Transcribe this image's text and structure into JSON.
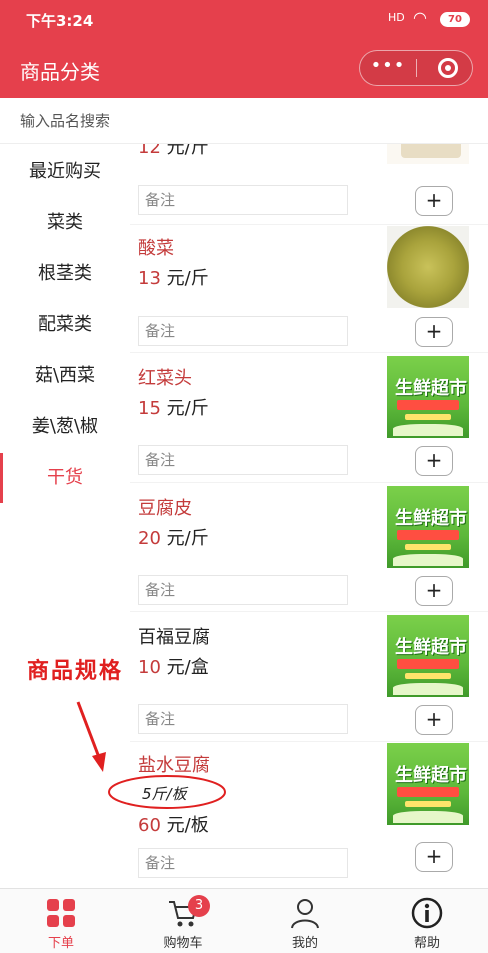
{
  "status": {
    "time": "下午3:24",
    "signal": "HD",
    "battery": "70"
  },
  "header": {
    "title": "商品分类",
    "more_glyph": "•••"
  },
  "search": {
    "placeholder": "输入品名搜索"
  },
  "sidebar": {
    "items": [
      {
        "label": "最近购买",
        "active": false
      },
      {
        "label": "菜类",
        "active": false
      },
      {
        "label": "根茎类",
        "active": false
      },
      {
        "label": "配菜类",
        "active": false
      },
      {
        "label": "菇\\西菜",
        "active": false
      },
      {
        "label": "姜\\葱\\椒",
        "active": false
      },
      {
        "label": "干货",
        "active": true
      }
    ]
  },
  "annotation": {
    "text": "商品规格",
    "color": "#e02020"
  },
  "products": [
    {
      "name": "",
      "price": "12",
      "unit": "元/斤",
      "remark_placeholder": "备注",
      "add": "+",
      "image": "partial"
    },
    {
      "name": "酸菜",
      "price": "13",
      "unit": "元/斤",
      "remark_placeholder": "备注",
      "add": "+",
      "image": "pickled-cabbage"
    },
    {
      "name": "红菜头",
      "price": "15",
      "unit": "元/斤",
      "remark_placeholder": "备注",
      "add": "+",
      "image": "fresh-market-banner",
      "banner_text": "生鲜超市"
    },
    {
      "name": "豆腐皮",
      "price": "20",
      "unit": "元/斤",
      "remark_placeholder": "备注",
      "add": "+",
      "image": "fresh-market-banner",
      "banner_text": "生鲜超市"
    },
    {
      "name": "百福豆腐",
      "price": "10",
      "unit": "元/盒",
      "remark_placeholder": "备注",
      "add": "+",
      "image": "fresh-market-banner",
      "banner_text": "生鲜超市"
    },
    {
      "name": "盐水豆腐",
      "spec": "5斤/板",
      "price": "60",
      "unit": "元/板",
      "remark_placeholder": "备注",
      "add": "+",
      "image": "fresh-market-banner",
      "banner_text": "生鲜超市"
    }
  ],
  "tabbar": {
    "items": [
      {
        "label": "下单",
        "icon": "grid-icon",
        "active": true
      },
      {
        "label": "购物车",
        "icon": "cart-icon",
        "badge": "3",
        "active": false
      },
      {
        "label": "我的",
        "icon": "user-icon",
        "active": false
      },
      {
        "label": "帮助",
        "icon": "info-icon",
        "active": false
      }
    ]
  },
  "colors": {
    "brand": "#e5404c",
    "price": "#c43b3b"
  }
}
